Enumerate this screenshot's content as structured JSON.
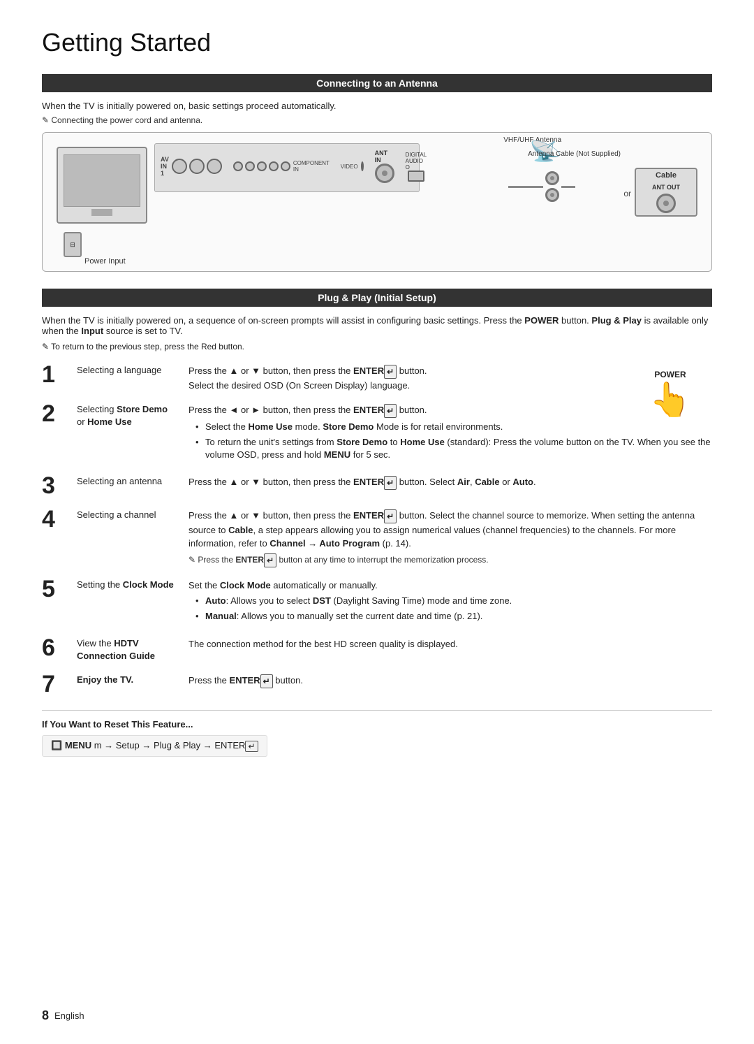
{
  "page": {
    "title": "Getting Started",
    "page_number": "8",
    "page_language": "English"
  },
  "antenna_section": {
    "header": "Connecting to an Antenna",
    "intro": "When the TV is initially powered on, basic settings proceed automatically.",
    "note": "Connecting the power cord and antenna.",
    "labels": {
      "vhf_antenna": "VHF/UHF Antenna",
      "antenna_cable": "Antenna Cable (Not Supplied)",
      "ant_in": "ANT IN",
      "digital_audio": "DIGITAL AUDIO O",
      "av_in": "AV IN 1",
      "component_in": "COMPONENT IN",
      "video": "VIDEO",
      "power_input": "Power Input",
      "cable": "Cable",
      "ant_out": "ANT OUT",
      "or": "or"
    }
  },
  "plug_play_section": {
    "header": "Plug & Play (Initial Setup)",
    "intro_part1": "When the TV is initially powered on, a sequence of on-screen prompts will assist in configuring basic settings. Press the",
    "intro_power": "POWER",
    "intro_part2": "button.",
    "intro_bold1": "Plug & Play",
    "intro_part3": "is available only when the",
    "intro_bold2": "Input",
    "intro_part4": "source is set to TV.",
    "note": "To return to the previous step, press the Red button.",
    "power_label": "POWER",
    "steps": [
      {
        "number": "1",
        "label": "Selecting a language",
        "content": "Press the ▲ or ▼ button, then press the ENTER↵ button. Select the desired OSD (On Screen Display) language.",
        "bullets": []
      },
      {
        "number": "2",
        "label_part1": "Selecting ",
        "label_bold": "Store Demo",
        "label_part2": " or ",
        "label_bold2": "Home Use",
        "content_main": "Press the ◄ or ► button, then press the ENTER↵ button.",
        "bullets": [
          "Select the Home Use mode. Store Demo Mode is for retail environments.",
          "To return the unit's settings from Store Demo to Home Use (standard): Press the volume button on the TV. When you see the volume OSD, press and hold MENU for 5 sec."
        ]
      },
      {
        "number": "3",
        "label": "Selecting an antenna",
        "content": "Press the ▲ or ▼ button, then press the ENTER↵ button. Select Air, Cable or Auto.",
        "bullets": []
      },
      {
        "number": "4",
        "label": "Selecting a channel",
        "content_part1": "Press the ▲ or ▼ button, then press the ENTER↵ button. Select the channel source to memorize. When setting the antenna source to",
        "content_bold": "Cable",
        "content_part2": ", a step appears allowing you to assign numerical values (channel frequencies) to the channels. For more information, refer to",
        "content_bold2": "Channel → Auto Program",
        "content_part3": "(p. 14).",
        "note": "Press the ENTER↵ button at any time to interrupt the memorization process.",
        "bullets": []
      },
      {
        "number": "5",
        "label_part1": "Setting the ",
        "label_bold": "Clock",
        "label_part2": "\nMode",
        "content_main": "Set the Clock Mode automatically or manually.",
        "bullets": [
          "Auto: Allows you to select DST (Daylight Saving Time) mode and time zone.",
          "Manual: Allows you to manually set the current date and time (p. 21)."
        ]
      },
      {
        "number": "6",
        "label_part1": "View the ",
        "label_bold": "HDTV\nConnection Guide",
        "content_main": "The connection method for the best HD screen quality is displayed.",
        "bullets": []
      },
      {
        "number": "7",
        "label_bold": "Enjoy the TV.",
        "content_main": "Press the ENTER↵ button.",
        "bullets": []
      }
    ]
  },
  "reset_section": {
    "title": "If You Want to Reset This Feature...",
    "command": "MENU m → Setup → Plug & Play → ENTER↵"
  }
}
